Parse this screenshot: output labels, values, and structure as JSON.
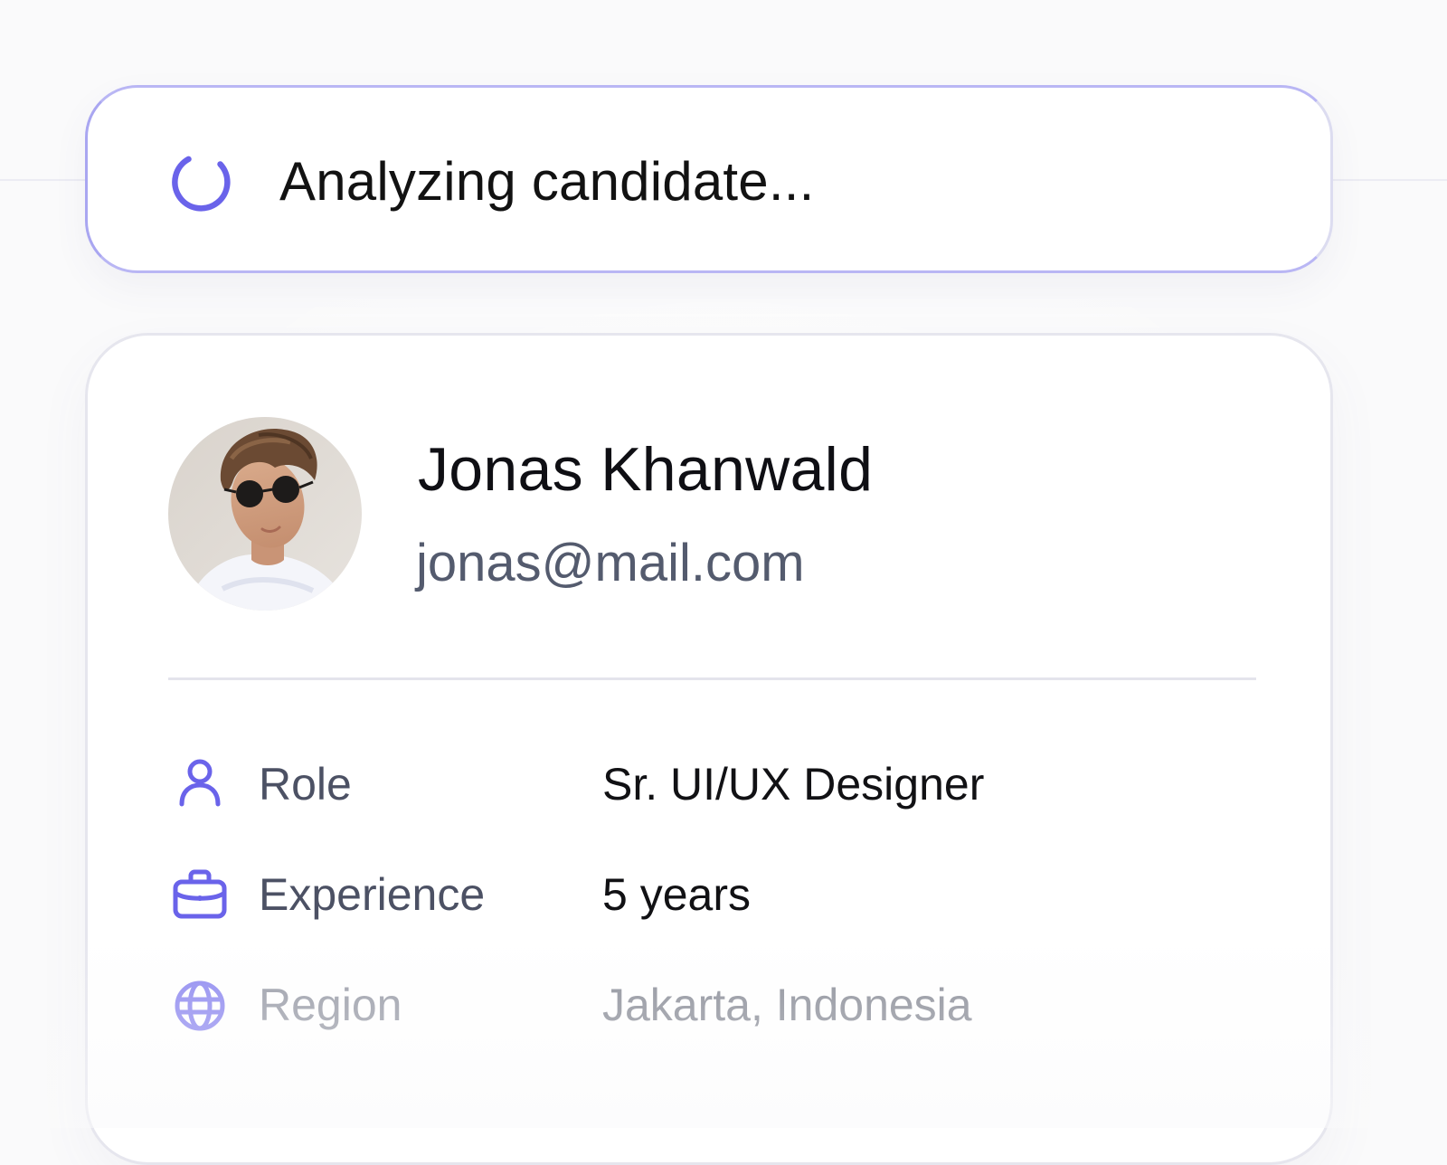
{
  "status": {
    "text": "Analyzing candidate...",
    "icon": "spinner-icon",
    "accent": "#6a63ea"
  },
  "candidate": {
    "name": "Jonas Khanwald",
    "email": "jonas@mail.com",
    "avatar": "avatar-photo"
  },
  "details": [
    {
      "icon": "user-icon",
      "label": "Role",
      "value": "Sr. UI/UX Designer"
    },
    {
      "icon": "briefcase-icon",
      "label": "Experience",
      "value": "5 years"
    },
    {
      "icon": "globe-icon",
      "label": "Region",
      "value": "Jakarta, Indonesia"
    }
  ],
  "colors": {
    "accent": "#6a63ea",
    "text_primary": "#0f0f14",
    "text_secondary": "#545b6e",
    "border": "#e6e6ee"
  }
}
